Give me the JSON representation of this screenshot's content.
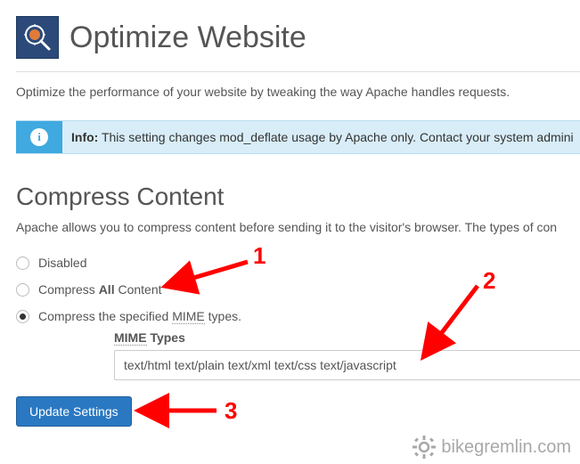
{
  "header": {
    "title": "Optimize Website"
  },
  "intro": "Optimize the performance of your website by tweaking the way Apache handles requests.",
  "info": {
    "label": "Info:",
    "text": " This setting changes mod_deflate usage by Apache only. Contact your system admini"
  },
  "section": {
    "title": "Compress Content",
    "desc": "Apache allows you to compress content before sending it to the visitor's browser. The types of con"
  },
  "radios": {
    "disabled": "Disabled",
    "all_pre": "Compress ",
    "all_bold": "All",
    "all_post": " Content",
    "mime_pre": "Compress the specified ",
    "mime_u": "MIME",
    "mime_post": " types."
  },
  "field": {
    "label_u": "MIME",
    "label_post": " Types",
    "value": "text/html text/plain text/xml text/css text/javascript"
  },
  "button": {
    "update": "Update Settings"
  },
  "annotations": {
    "n1": "1",
    "n2": "2",
    "n3": "3"
  },
  "watermark": "bikegremlin.com"
}
